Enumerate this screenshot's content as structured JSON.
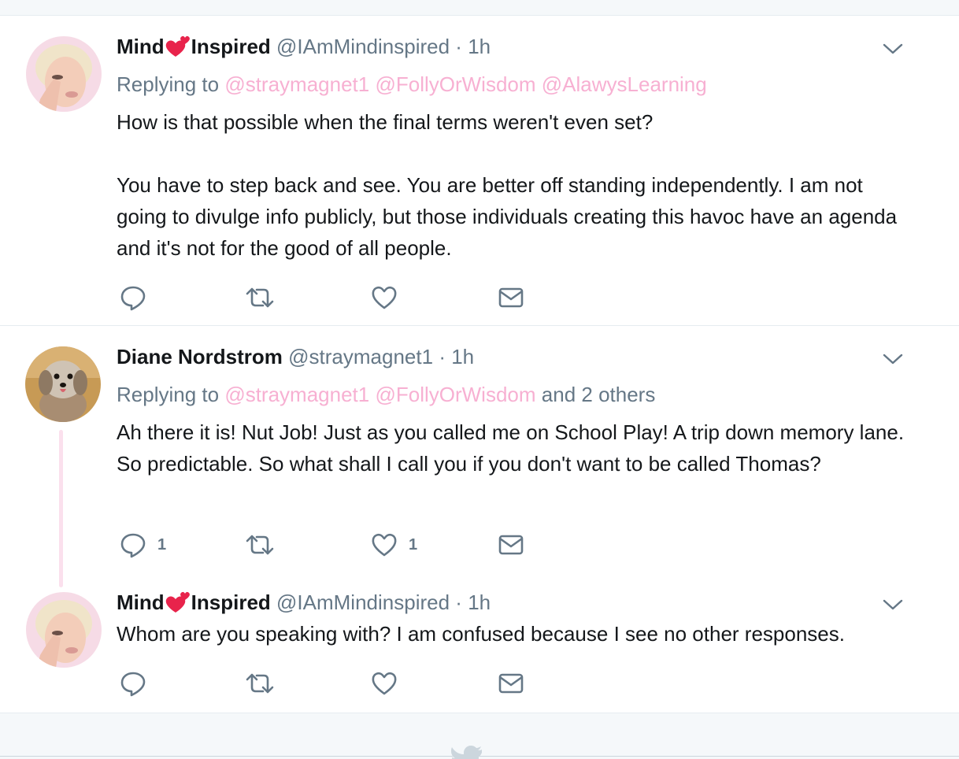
{
  "tweets": [
    {
      "name_part1": "Mind",
      "name_part2": "Inspired",
      "handle": "@IAmMindinspired",
      "separator": "·",
      "time": "1h",
      "replying_prefix": "Replying to",
      "mentions": [
        "@straymagnet1",
        "@FollyOrWisdom",
        "@AlawysLearning"
      ],
      "paragraphs": [
        "How is that possible when the final terms weren't even set?",
        "You have to step back and see. You are better off standing independently. I am not going to divulge info publicly, but those individuals creating this havoc have an agenda and it's not for the good of all people."
      ],
      "reply_count": "",
      "like_count": ""
    },
    {
      "name": "Diane Nordstrom",
      "handle": "@straymagnet1",
      "separator": "·",
      "time": "1h",
      "replying_prefix": "Replying to",
      "mentions": [
        "@straymagnet1",
        "@FollyOrWisdom"
      ],
      "replying_suffix": "and 2 others",
      "paragraphs": [
        "Ah there it is! Nut Job! Just as you called me on School Play! A trip down memory lane. So predictable. So what shall I call you if you don't want to be called Thomas?"
      ],
      "reply_count": "1",
      "like_count": "1"
    },
    {
      "name_part1": "Mind",
      "name_part2": "Inspired",
      "handle": "@IAmMindinspired",
      "separator": "·",
      "time": "1h",
      "paragraphs": [
        "Whom are you speaking with? I am confused because I see no other responses."
      ],
      "reply_count": "",
      "like_count": ""
    }
  ],
  "icons": {
    "reply": "speech-bubble-icon",
    "retweet": "retweet-arrows-icon",
    "like": "heart-outline-icon",
    "dm": "envelope-icon",
    "menu": "chevron-down-icon",
    "emoji": "two-hearts-emoji-icon",
    "brand": "twitter-bird-icon"
  },
  "colors": {
    "text": "#14171a",
    "secondary": "#657786",
    "mention": "#f7b0d2",
    "thread_line": "#fbe0ed",
    "emoji_heart": "#e8234b"
  }
}
